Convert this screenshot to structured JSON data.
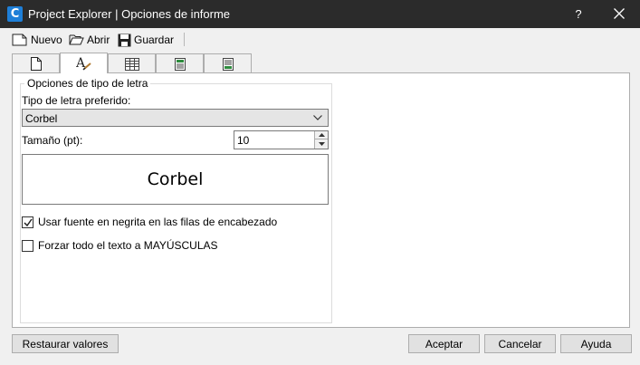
{
  "window": {
    "app_icon_letter": "C",
    "title": "Project Explorer | Opciones de informe",
    "help_label": "?"
  },
  "toolbar": {
    "new_label": "Nuevo",
    "open_label": "Abrir",
    "save_label": "Guardar"
  },
  "tabs": [
    {
      "icon": "document-icon",
      "active": false
    },
    {
      "icon": "font-format-icon",
      "active": true
    },
    {
      "icon": "table-grid-icon",
      "active": false
    },
    {
      "icon": "header-rows-icon",
      "active": false
    },
    {
      "icon": "footer-rows-icon",
      "active": false
    }
  ],
  "font_options": {
    "group_title": "Opciones de tipo de letra",
    "preferred_font_label": "Tipo de letra preferido:",
    "preferred_font_value": "Corbel",
    "size_label": "Tamaño (pt):",
    "size_value": "10",
    "preview_text": "Corbel",
    "bold_header_label": "Usar fuente en negrita en las filas de encabezado",
    "bold_header_checked": true,
    "uppercase_label": "Forzar todo el texto a MAYÚSCULAS",
    "uppercase_checked": false
  },
  "buttons": {
    "restore_label": "Restaurar valores",
    "accept_label": "Aceptar",
    "cancel_label": "Cancelar",
    "help_label": "Ayuda"
  },
  "colors": {
    "titlebar": "#2b2b2b",
    "app_icon": "#1e7fd8",
    "tab_icon_green": "#2e8b3e"
  }
}
